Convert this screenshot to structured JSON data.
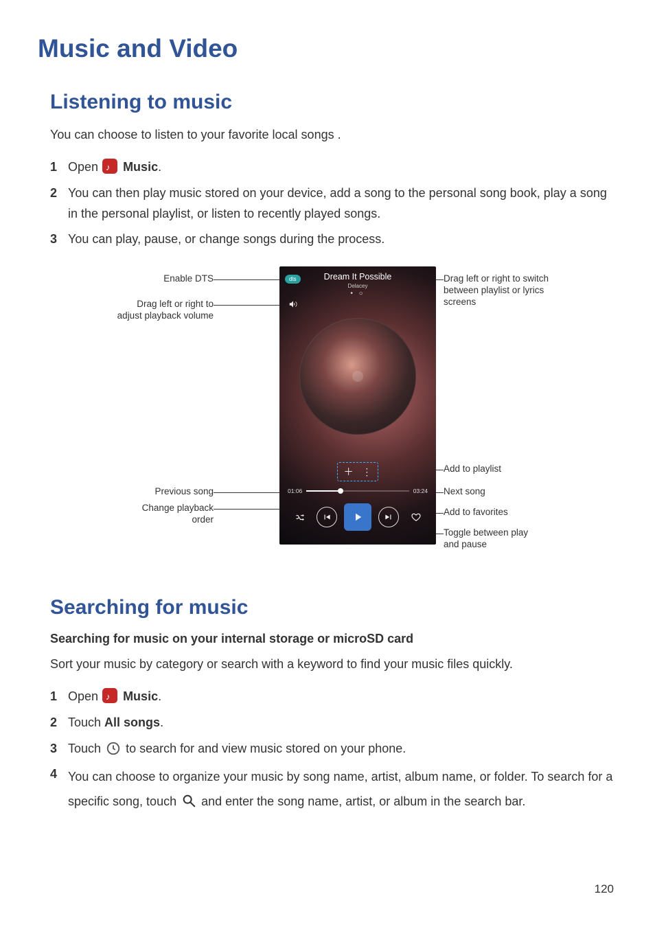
{
  "doc": {
    "title": "Music and Video",
    "page_number": "120"
  },
  "section_listening": {
    "heading": "Listening to music",
    "intro": "You can choose to listen to your favorite local songs .",
    "steps": {
      "s1_num": "1",
      "s1_a": "Open ",
      "s1_b": "Music",
      "s1_c": ".",
      "s2_num": "2",
      "s2": "You can then play music stored on your device, add a song to the personal song book, play a song in the personal playlist, or listen to recently played songs.",
      "s3_num": "3",
      "s3": "You can play, pause, or change songs during the process."
    }
  },
  "figure": {
    "callouts": {
      "enable_dts": "Enable DTS",
      "drag_volume": "Drag left or right to\nadjust playback volume",
      "switch_screens": "Drag left or right to switch\nbetween playlist or lyrics\nscreens",
      "add_playlist": "Add to playlist",
      "previous_song": "Previous song",
      "next_song": "Next song",
      "change_order": "Change playback\norder",
      "add_favorites": "Add to favorites",
      "toggle_play": "Toggle between play\nand pause"
    },
    "phone": {
      "dts_badge": "dts",
      "song_title": "Dream It Possible",
      "song_artist": "Delacey",
      "time_elapsed": "01:06",
      "time_total": "03:24"
    }
  },
  "section_searching": {
    "heading": "Searching for music",
    "subheading": "Searching for music on your internal storage or microSD card",
    "intro": "Sort your music by category or search with a keyword to find your music files quickly.",
    "steps": {
      "s1_num": "1",
      "s1_a": "Open ",
      "s1_b": "Music",
      "s1_c": ".",
      "s2_num": "2",
      "s2_a": "Touch ",
      "s2_b": "All songs",
      "s2_c": ".",
      "s3_num": "3",
      "s3_a": "Touch ",
      "s3_b": " to search for and view music stored on your phone.",
      "s4_num": "4",
      "s4_a": "You can choose to organize your music by song name, artist, album name, or folder. To search for a specific song, touch ",
      "s4_b": " and enter the song name, artist, or album in the search bar."
    }
  }
}
